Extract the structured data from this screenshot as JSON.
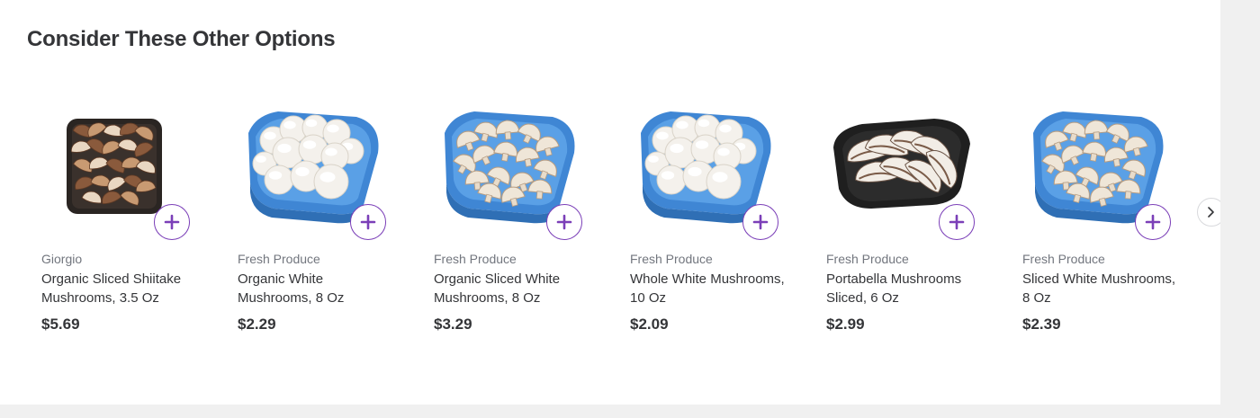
{
  "section": {
    "title": "Consider These Other Options"
  },
  "colors": {
    "accent": "#7b3fb8",
    "text": "#343538",
    "muted": "#72767e",
    "tray_blue": "#4a8fd6",
    "tray_black": "#2b2b2b"
  },
  "products": [
    {
      "brand": "Giorgio",
      "name": "Organic Sliced Shiitake Mushrooms, 3.5 Oz",
      "price": "$5.69",
      "image_icon": "shiitake-tray-icon"
    },
    {
      "brand": "Fresh Produce",
      "name": "Organic White Mushrooms, 8 Oz",
      "price": "$2.29",
      "image_icon": "whole-mushroom-tray-icon"
    },
    {
      "brand": "Fresh Produce",
      "name": "Organic Sliced White Mushrooms, 8 Oz",
      "price": "$3.29",
      "image_icon": "sliced-mushroom-tray-icon"
    },
    {
      "brand": "Fresh Produce",
      "name": "Whole White Mushrooms, 10 Oz",
      "price": "$2.09",
      "image_icon": "whole-mushroom-tray-icon"
    },
    {
      "brand": "Fresh Produce",
      "name": "Portabella Mushrooms Sliced, 6 Oz",
      "price": "$2.99",
      "image_icon": "portabella-tray-icon"
    },
    {
      "brand": "Fresh Produce",
      "name": "Sliced White Mushrooms, 8 Oz",
      "price": "$2.39",
      "image_icon": "sliced-mushroom-tray-icon"
    }
  ],
  "controls": {
    "add_icon": "plus-icon",
    "next_icon": "chevron-right-icon"
  }
}
